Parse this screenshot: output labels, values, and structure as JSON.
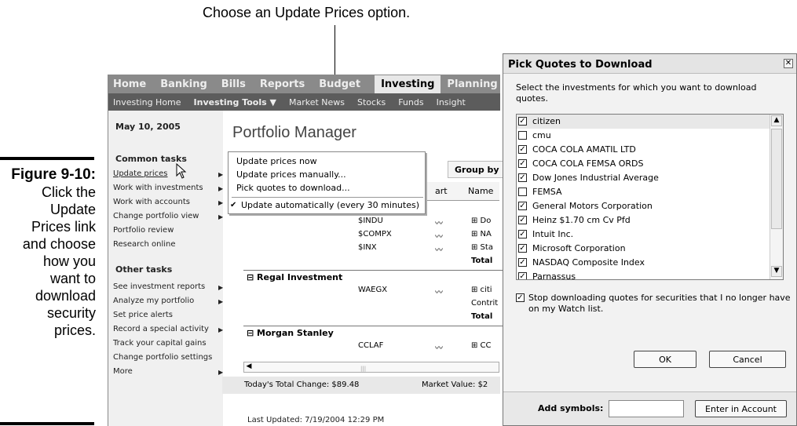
{
  "callout": "Choose an Update Prices option.",
  "figure": {
    "title": "Figure 9-10:",
    "caption_lines": [
      "Click the",
      "Update",
      "Prices link",
      "and choose",
      "how you",
      "want to",
      "download",
      "security",
      "prices."
    ]
  },
  "nav": {
    "tabs": [
      "Home",
      "Banking",
      "Bills",
      "Reports",
      "Budget",
      "Investing",
      "Planning"
    ],
    "active_tab": "Investing",
    "subtabs": [
      "Investing Home",
      "Investing Tools ▼",
      "Market News",
      "Stocks",
      "Funds",
      "Insight"
    ]
  },
  "sidebar": {
    "date": "May 10, 2005",
    "common_title": "Common tasks",
    "common_items": [
      "Update prices",
      "Work with investments",
      "Work with accounts",
      "Change portfolio view",
      "Portfolio review",
      "Research online"
    ],
    "other_title": "Other tasks",
    "other_items": [
      "See investment reports",
      "Analyze my portfolio",
      "Set price alerts",
      "Record a special activity",
      "Track your capital gains",
      "Change portfolio settings",
      "More"
    ]
  },
  "main": {
    "title": "Portfolio Manager",
    "group_by": "Group by",
    "columns": [
      "art",
      "Name"
    ],
    "rows": [
      {
        "symbol": "$INDU",
        "name": "⊞ Do"
      },
      {
        "symbol": "$COMPX",
        "name": "⊞ NA"
      },
      {
        "symbol": "$INX",
        "name": "⊞ Sta"
      },
      {
        "total": "Total"
      },
      {
        "group": "⊟ Regal Investment"
      },
      {
        "symbol": "WAEGX",
        "name": "⊞ citi"
      },
      {
        "label": "Contrit"
      },
      {
        "total": "Total"
      },
      {
        "group": "⊟ Morgan Stanley"
      },
      {
        "symbol": "CCLAF",
        "name": "⊞ CC"
      }
    ],
    "status_change": "Today's Total Change: $89.48",
    "status_market": "Market Value: $2",
    "last_updated": "Last Updated: 7/19/2004 12:29 PM"
  },
  "menu": {
    "items": [
      "Update prices now",
      "Update prices manually...",
      "Pick quotes to download...",
      "Update automatically (every 30 minutes)"
    ],
    "checked_item": "Update automatically (every 30 minutes)"
  },
  "dialog": {
    "title": "Pick Quotes to Download",
    "instructions": "Select the investments for which you want to download quotes.",
    "items": [
      {
        "label": "citizen",
        "checked": true
      },
      {
        "label": "cmu",
        "checked": false
      },
      {
        "label": "COCA COLA AMATIL LTD",
        "checked": true
      },
      {
        "label": "COCA COLA FEMSA ORDS",
        "checked": true
      },
      {
        "label": "Dow Jones Industrial Average",
        "checked": true
      },
      {
        "label": "FEMSA",
        "checked": false
      },
      {
        "label": "General Motors Corporation",
        "checked": true
      },
      {
        "label": "Heinz $1.70 cm Cv Pfd",
        "checked": true
      },
      {
        "label": "Intuit Inc.",
        "checked": true
      },
      {
        "label": "Microsoft Corporation",
        "checked": true
      },
      {
        "label": "NASDAQ Composite Index",
        "checked": true
      },
      {
        "label": "Parnassus",
        "checked": true
      }
    ],
    "stop_text": "Stop downloading quotes for securities that I no longer have on my Watch list.",
    "stop_checked": true,
    "ok": "OK",
    "cancel": "Cancel",
    "add_symbols_label": "Add symbols:",
    "add_symbols_value": "",
    "enter_button": "Enter in Account"
  }
}
